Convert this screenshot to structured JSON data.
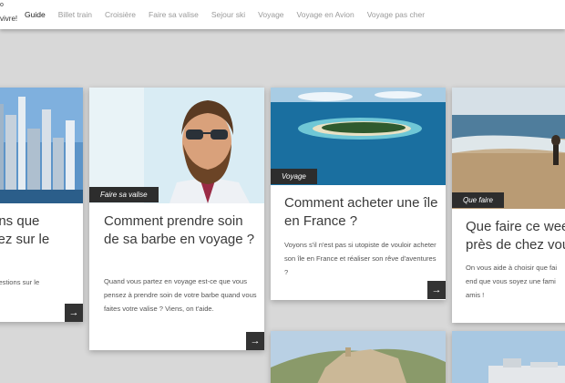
{
  "header": {
    "logo_top": "o",
    "logo_tagline": "vivre!",
    "nav": [
      {
        "label": "Guide",
        "active": true
      },
      {
        "label": "Billet train",
        "active": false
      },
      {
        "label": "Croisière",
        "active": false
      },
      {
        "label": "Faire sa valise",
        "active": false
      },
      {
        "label": "Sejour ski",
        "active": false
      },
      {
        "label": "Voyage",
        "active": false
      },
      {
        "label": "Voyage en Avion",
        "active": false
      },
      {
        "label": "Voyage pas cher",
        "active": false
      }
    ]
  },
  "cards": [
    {
      "title_lines": [
        "ons que",
        "sez sur le"
      ],
      "excerpt": "questions sur le",
      "arrow": "→"
    },
    {
      "category": "Faire sa valise",
      "title": "Comment prendre soin de sa barbe en voyage ?",
      "excerpt": "Quand vous partez en voyage est-ce que vous pensez à prendre soin de votre barbe quand vous faites votre valise ? Viens, on t'aide.",
      "arrow": "→"
    },
    {
      "category": "Voyage",
      "title": "Comment acheter une île en France ?",
      "excerpt": "Voyons s'il n'est pas si utopiste de vouloir acheter son île en France et réaliser son rêve d'aventures ?",
      "arrow": "→"
    },
    {
      "category": "Que faire",
      "title_lines": [
        "Que faire ce wee",
        "près de chez vou"
      ],
      "excerpt_lines": [
        "On vous aide à choisir que fai",
        "end que vous soyez une fami",
        "amis !"
      ]
    }
  ]
}
